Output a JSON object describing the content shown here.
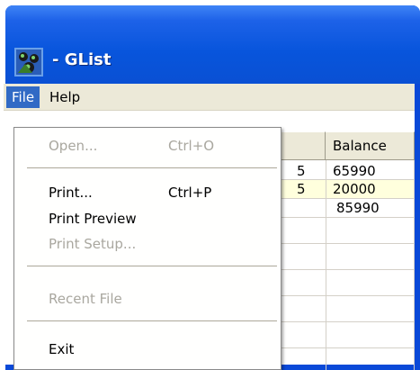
{
  "window": {
    "title": "- GList",
    "icon": "glist-app-icon"
  },
  "menubar": {
    "items": [
      {
        "label": "File",
        "state": "open"
      },
      {
        "label": "Help",
        "state": "normal"
      }
    ]
  },
  "file_menu": {
    "items": [
      {
        "label": "Open...",
        "accel": "Ctrl+O",
        "enabled": false
      },
      {
        "label": "Print...",
        "accel": "Ctrl+P",
        "enabled": true
      },
      {
        "label": "Print Preview",
        "accel": "",
        "enabled": true
      },
      {
        "label": "Print Setup...",
        "accel": "",
        "enabled": false
      },
      {
        "label": "Recent File",
        "accel": "",
        "enabled": false
      },
      {
        "label": "Exit",
        "accel": "",
        "enabled": true
      }
    ]
  },
  "grid": {
    "columns": [
      "",
      "Balance"
    ],
    "rows": [
      {
        "a": "5",
        "balance": "65990"
      },
      {
        "a": "5",
        "balance": "20000"
      },
      {
        "a": "",
        "balance": "85990"
      }
    ]
  },
  "colors": {
    "titlebar": "#0a49d8",
    "menu_highlight": "#316ac5",
    "row_highlight": "#ffffdd"
  }
}
